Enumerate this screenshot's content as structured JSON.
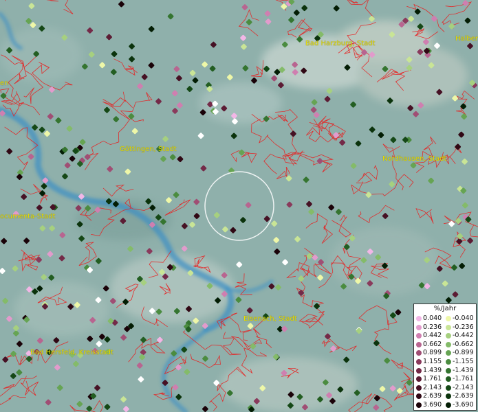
{
  "map": {
    "cities": [
      {
        "name": "Bad Harzburg, Stadt",
        "id": "city-bad-harzburg"
      },
      {
        "name": "Halber",
        "id": "city-halber"
      },
      {
        "name": "en",
        "id": "city-en"
      },
      {
        "name": "Göttingen, Stadt",
        "id": "city-goettingen"
      },
      {
        "name": "Nordhausen, Stadt",
        "id": "city-nordhausen"
      },
      {
        "name": "ocumenta-Stadt",
        "id": "city-documenta"
      },
      {
        "name": "Eisenach, Stadt",
        "id": "city-eisenach"
      },
      {
        "name": "Bad Hersfeld, Kreisstadt",
        "id": "city-bad-hersfeld"
      }
    ],
    "legend": {
      "title": "%/Jahr",
      "positive": [
        {
          "label": "0.040",
          "color": "#f2b6e6"
        },
        {
          "label": "0.236",
          "color": "#e29bcc"
        },
        {
          "label": "0.442",
          "color": "#cf7fb0"
        },
        {
          "label": "0.662",
          "color": "#b86590"
        },
        {
          "label": "0.899",
          "color": "#a04e74"
        },
        {
          "label": "1.155",
          "color": "#8a3a5c"
        },
        {
          "label": "1.439",
          "color": "#742a48"
        },
        {
          "label": "1.761",
          "color": "#5c1c34"
        },
        {
          "label": "2.143",
          "color": "#461124"
        },
        {
          "label": "2.639",
          "color": "#300814"
        },
        {
          "label": "3.690",
          "color": "#1a0208"
        }
      ],
      "negative": [
        {
          "label": "-0.040",
          "color": "#eef7a8"
        },
        {
          "label": "-0.236",
          "color": "#c9e596"
        },
        {
          "label": "-0.442",
          "color": "#a6d07f"
        },
        {
          "label": "-0.662",
          "color": "#84bb69"
        },
        {
          "label": "-0.899",
          "color": "#66a453"
        },
        {
          "label": "-1.155",
          "color": "#4b8c40"
        },
        {
          "label": "-1.439",
          "color": "#357530"
        },
        {
          "label": "-1.761",
          "color": "#235e22"
        },
        {
          "label": "-2.143",
          "color": "#154816"
        },
        {
          "label": "-2.639",
          "color": "#0b330c"
        },
        {
          "label": "-3.690",
          "color": "#031d04"
        }
      ]
    },
    "colors": {
      "terrain_light": "#a6c3c0",
      "terrain_dark": "#6f9793",
      "river": "#3c8fc4",
      "boundary": "#e82020",
      "label": "#e8e000",
      "marker_white": "#ffffff"
    },
    "search_circle": "circle-selection"
  }
}
